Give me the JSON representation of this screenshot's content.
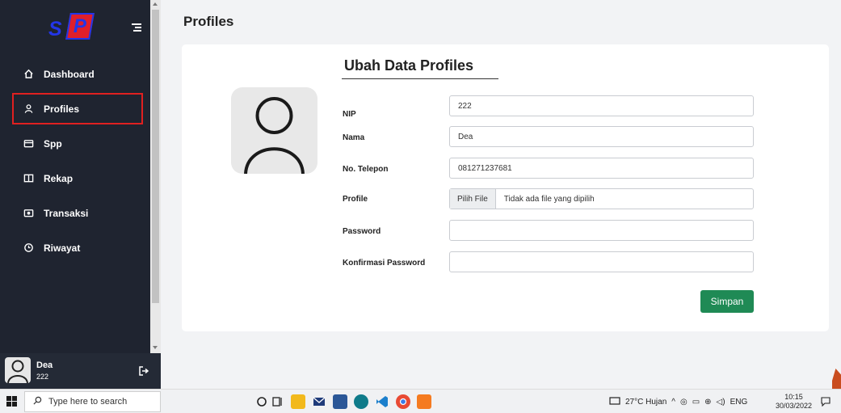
{
  "sidebar": {
    "logo_text": "SPP",
    "items": [
      {
        "label": "Dashboard",
        "icon": "home-icon"
      },
      {
        "label": "Profiles",
        "icon": "user-icon"
      },
      {
        "label": "Spp",
        "icon": "wallet-icon"
      },
      {
        "label": "Rekap",
        "icon": "book-icon"
      },
      {
        "label": "Transaksi",
        "icon": "camera-icon"
      },
      {
        "label": "Riwayat",
        "icon": "history-icon"
      }
    ],
    "active_item": "Profiles",
    "user": {
      "name": "Dea",
      "id": "222"
    }
  },
  "main": {
    "page_title": "Profiles",
    "form": {
      "title": "Ubah Data Profiles",
      "fields": [
        {
          "label": "NIP",
          "value": "222"
        },
        {
          "label": "Nama",
          "value": "Dea"
        },
        {
          "label": "No. Telepon",
          "value": "081271237681"
        },
        {
          "label": "Profile",
          "file_button": "Pilih File",
          "file_status": "Tidak ada file yang dipilih"
        },
        {
          "label": "Password",
          "value": ""
        },
        {
          "label": "Konfirmasi Password",
          "value": ""
        }
      ],
      "submit_label": "Simpan"
    }
  },
  "taskbar": {
    "search_placeholder": "Type here to search",
    "weather": "27°C  Hujan",
    "language": "ENG",
    "time": "10:15",
    "date": "30/03/2022"
  },
  "colors": {
    "sidebar_bg": "#1f2430",
    "active_outline": "#e02020",
    "save_button": "#1f8a55"
  }
}
